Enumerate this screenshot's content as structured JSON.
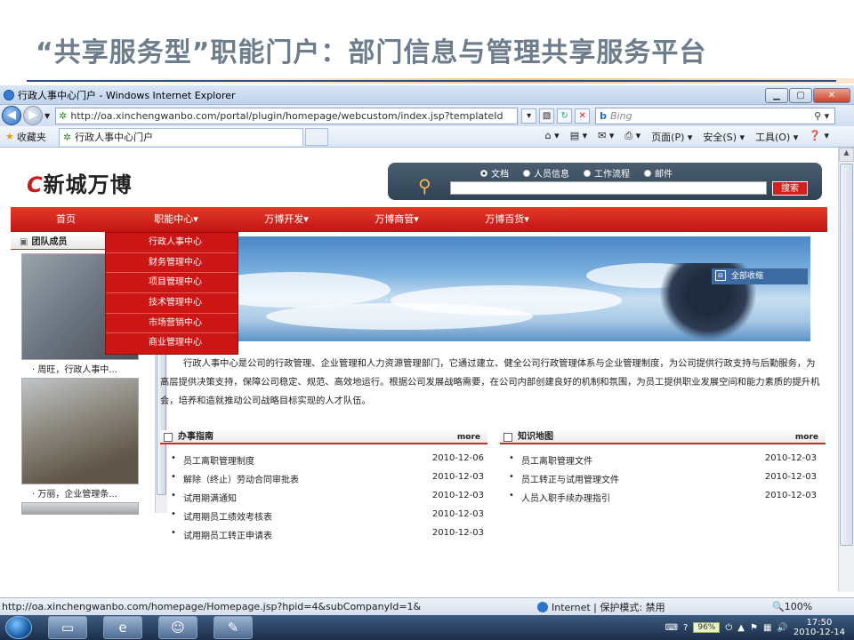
{
  "slide": {
    "title": "“共享服务型”职能门户：部门信息与管理共享服务平台"
  },
  "browser": {
    "window_title": "行政人事中心门户 - Windows Internet Explorer",
    "url": "http://oa.xinchengwanbo.com/portal/plugin/homepage/webcustom/index.jsp?templateId",
    "search_placeholder": "Bing",
    "favorites_label": "收藏夹",
    "tab_title": "行政人事中心门户",
    "commands": [
      "页面(P) ▾",
      "安全(S) ▾",
      "工具(O) ▾",
      "❓ ▾"
    ],
    "status_url": "http://oa.xinchengwanbo.com/homepage/Homepage.jsp?hpid=4&subCompanyId=1&",
    "status_zone": "Internet | 保护模式: 禁用",
    "zoom": "🔍100%"
  },
  "site": {
    "logo_text": "新城万博",
    "search_options": [
      "文档",
      "人员信息",
      "工作流程",
      "邮件"
    ],
    "search_selected": "文档",
    "search_button": "搜索",
    "menu": [
      "首页",
      "职能中心▾",
      "万博开发▾",
      "万博商管▾",
      "万博百货▾"
    ],
    "dropdown": [
      "行政人事中心",
      "财务管理中心",
      "项目管理中心",
      "技术管理中心",
      "市场营销中心",
      "商业管理中心"
    ],
    "all_collapse": "全部收缩",
    "team_title": "团队成员",
    "team_members": [
      "· 周旺，行政人事中...",
      "· 万丽，企业管理条..."
    ],
    "intro": "行政人事中心是公司的行政管理、企业管理和人力资源管理部门，它通过建立、健全公司行政管理体系与企业管理制度，为公司提供行政支持与后勤服务，为高层提供决策支持，保障公司稳定、规范、高效地运行。根据公司发展战略需要，在公司内部创建良好的机制和氛围，为员工提供职业发展空间和能力素质的提升机会，培养和造就推动公司战略目标实现的人才队伍。",
    "guide": {
      "title": "办事指南",
      "more": "more",
      "items": [
        {
          "title": "员工离职管理制度",
          "date": "2010-12-06"
        },
        {
          "title": "解除（终止）劳动合同审批表",
          "date": "2010-12-03"
        },
        {
          "title": "试用期满通知",
          "date": "2010-12-03"
        },
        {
          "title": "试用期员工绩效考核表",
          "date": "2010-12-03"
        },
        {
          "title": "试用期员工转正申请表",
          "date": "2010-12-03"
        }
      ]
    },
    "knowledge": {
      "title": "知识地图",
      "more": "more",
      "items": [
        {
          "title": "员工离职管理文件",
          "date": "2010-12-03"
        },
        {
          "title": "员工转正与试用管理文件",
          "date": "2010-12-03"
        },
        {
          "title": "人员入职手续办理指引",
          "date": "2010-12-03"
        }
      ]
    }
  },
  "taskbar": {
    "battery": "96%",
    "time": "17:50",
    "date": "2010-12-14"
  }
}
